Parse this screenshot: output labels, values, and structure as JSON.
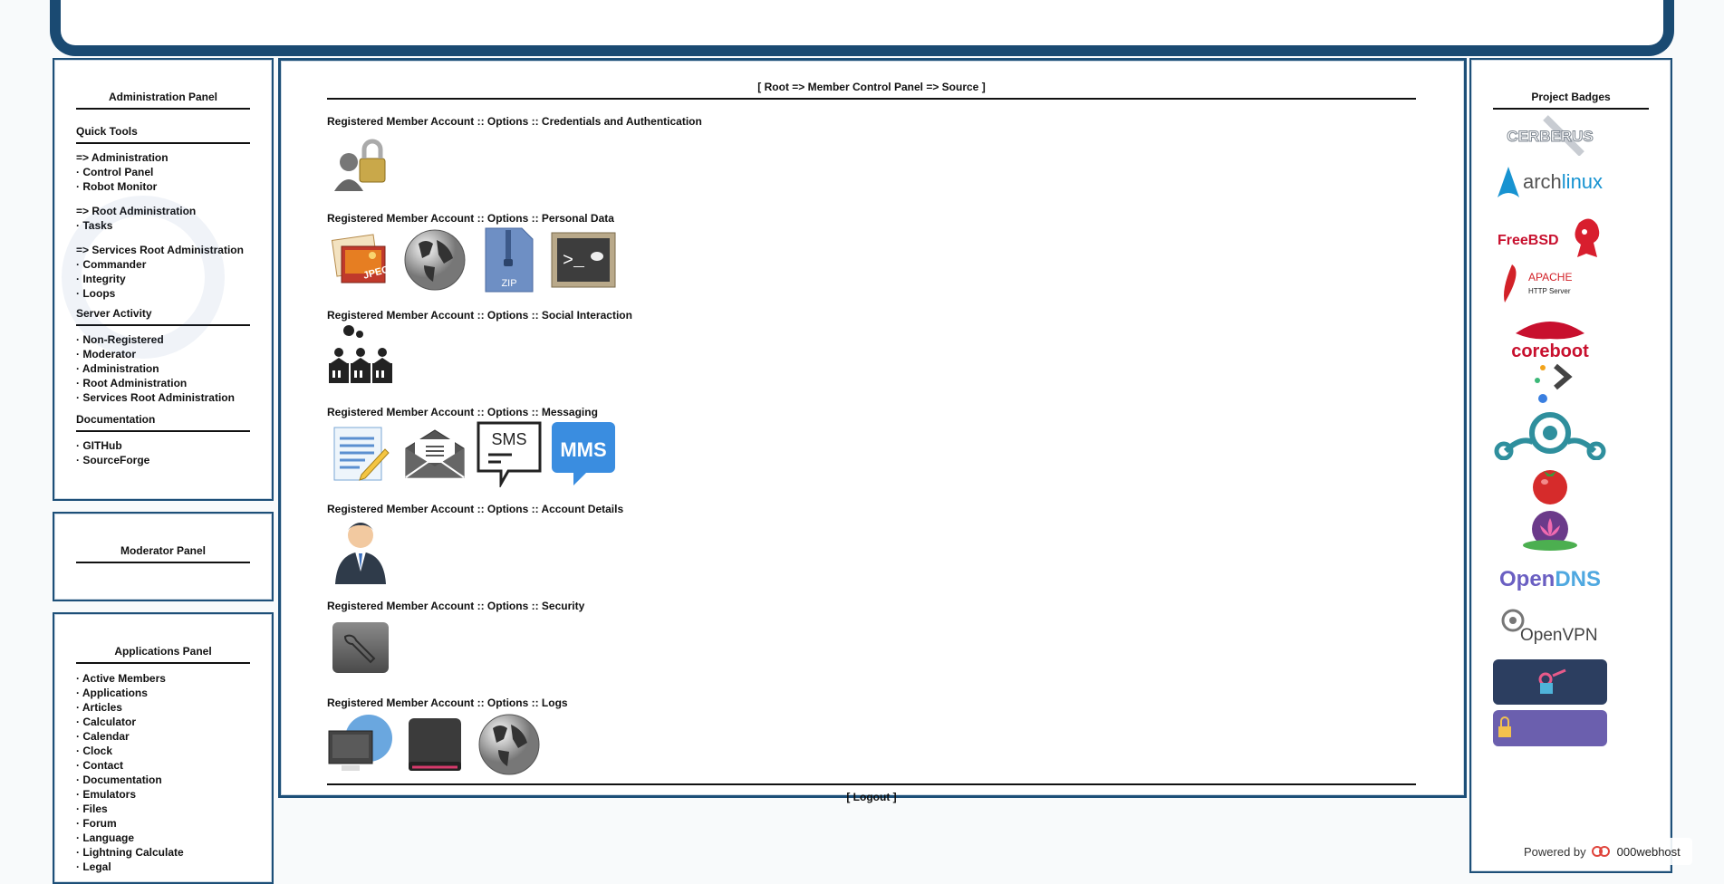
{
  "admin_panel": {
    "title": "Administration Panel",
    "quick_tools": {
      "heading": "Quick Tools",
      "groups": [
        {
          "head": "Administration",
          "items": [
            "Control Panel",
            "Robot Monitor"
          ]
        },
        {
          "head": "Root Administration",
          "items": [
            "Tasks"
          ]
        },
        {
          "head": "Services Root Administration",
          "items": [
            "Commander",
            "Integrity",
            "Loops"
          ]
        }
      ]
    },
    "server_activity": {
      "heading": "Server Activity",
      "items": [
        "Non-Registered",
        "Moderator",
        "Administration",
        "Root Administration",
        "Services Root Administration"
      ]
    },
    "documentation": {
      "heading": "Documentation",
      "items": [
        "GITHub",
        "SourceForge"
      ]
    }
  },
  "moderator_panel": {
    "title": "Moderator Panel"
  },
  "apps_panel": {
    "title": "Applications Panel",
    "items": [
      "Active Members",
      "Applications",
      "Articles",
      "Calculator",
      "Calendar",
      "Clock",
      "Contact",
      "Documentation",
      "Emulators",
      "Files",
      "Forum",
      "Language",
      "Lightning Calculate",
      "Legal"
    ]
  },
  "main": {
    "breadcrumb_open": "[",
    "breadcrumb": "Root => Member Control Panel => Source",
    "breadcrumb_close": "]",
    "groups": [
      {
        "title": "Registered Member Account :: Options :: Credentials and Authentication",
        "icons": [
          "lock-user-icon"
        ]
      },
      {
        "title": "Registered Member Account :: Options :: Personal Data",
        "icons": [
          "jpeg-photo-icon",
          "globe-icon",
          "zip-file-icon",
          "terminal-icon"
        ]
      },
      {
        "title": "Registered Member Account :: Options :: Social Interaction",
        "icons": [
          "conference-icon"
        ]
      },
      {
        "title": "Registered Member Account :: Options :: Messaging",
        "icons": [
          "notepad-icon",
          "envelope-icon",
          "sms-icon",
          "mms-icon"
        ]
      },
      {
        "title": "Registered Member Account :: Options :: Account Details",
        "icons": [
          "businessman-icon"
        ]
      },
      {
        "title": "Registered Member Account :: Options :: Security",
        "icons": [
          "wrench-icon"
        ]
      },
      {
        "title": "Registered Member Account :: Options :: Logs",
        "icons": [
          "monitor-globe-icon",
          "drive-icon",
          "globe-icon"
        ]
      }
    ],
    "sms_label": "SMS",
    "mms_label": "MMS",
    "jpeg_label": "JPEG",
    "zip_label": "ZIP",
    "logout_open": "[",
    "logout": "Logout",
    "logout_close": "]"
  },
  "badges_panel": {
    "title": "Project Badges",
    "badges": [
      {
        "name": "cerberus-badge",
        "label": "CERBERUS",
        "color": "#9aa4ad"
      },
      {
        "name": "archlinux-badge",
        "label": "archlinux",
        "color": "#1793d1"
      },
      {
        "name": "freebsd-badge",
        "label": "FreeBSD",
        "color": "#c8102e"
      },
      {
        "name": "apache-badge",
        "label": "APACHE",
        "sublabel": "HTTP Server",
        "color": "#d22128"
      },
      {
        "name": "coreboot-badge",
        "label": "coreboot",
        "color": "#c8102e"
      },
      {
        "name": "prompt-badge",
        "label": "",
        "color": "#444"
      },
      {
        "name": "lineageos-badge",
        "label": "",
        "color": "#2f8f9d"
      },
      {
        "name": "tomato-badge",
        "label": "",
        "color": "#d62b2b"
      },
      {
        "name": "lotus-badge",
        "label": "",
        "color": "#8a3fa0"
      },
      {
        "name": "opendns-badge",
        "label": "OpenDNS",
        "color": "#6a5fc2"
      },
      {
        "name": "openvpn-badge",
        "label": "OpenVPN",
        "color": "#444"
      },
      {
        "name": "keys-badge",
        "label": "",
        "color": "#2c3e60"
      },
      {
        "name": "lock-badge",
        "label": "",
        "color": "#6b5fae"
      }
    ]
  },
  "powered_by": {
    "prefix": "Powered by",
    "brand": "000webhost"
  }
}
